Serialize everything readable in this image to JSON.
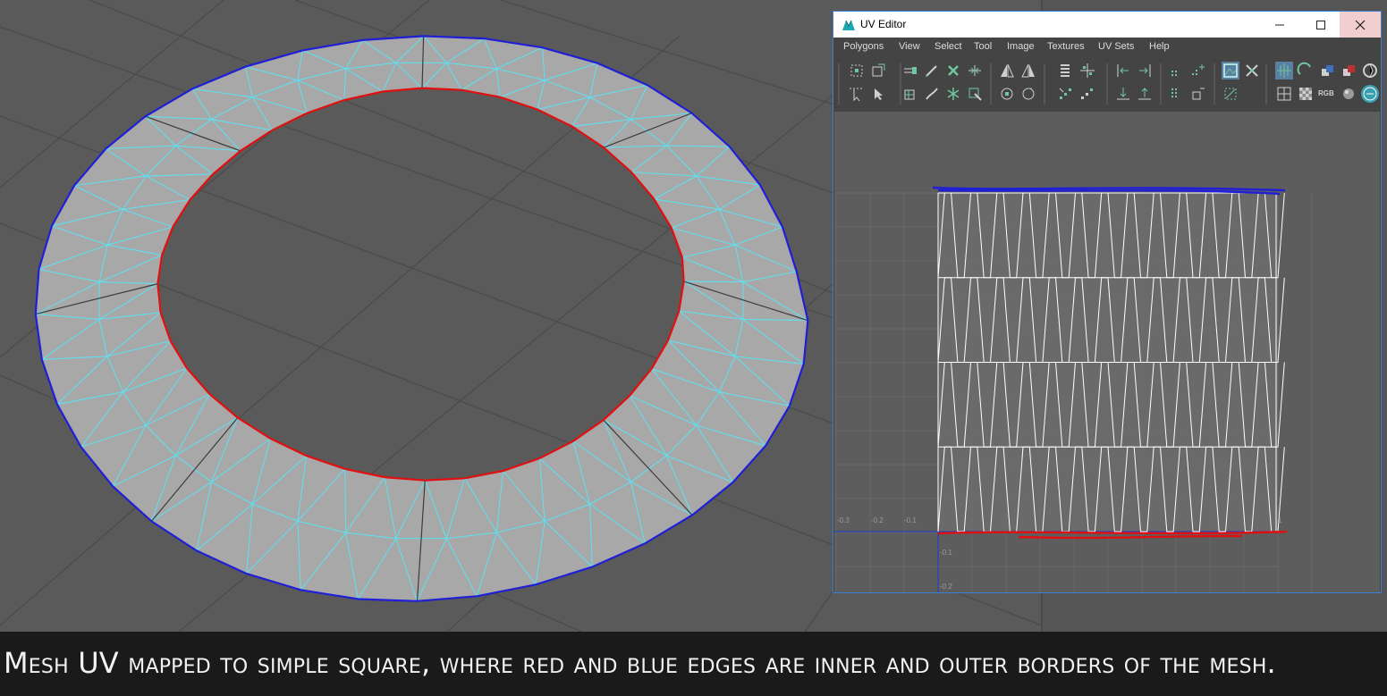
{
  "uv_editor": {
    "title": "UV Editor",
    "menu": [
      "Polygons",
      "View",
      "Select",
      "Tool",
      "Image",
      "Textures",
      "UV Sets",
      "Help"
    ],
    "toolbar_text": {
      "rgb_label": "RGB"
    },
    "axis_labels": {
      "u_negative": [
        "-0.3",
        "-0.2",
        "-0.1"
      ],
      "v_negative": [
        "-0.1",
        "-0.2"
      ],
      "u_one": "1"
    }
  },
  "caption": "Mesh UV mapped to simple square, where red and blue edges are inner and outer borders of the mesh.",
  "colors": {
    "outer_border": "#1f1fd6",
    "inner_border": "#e01010",
    "wireframe": "#5fe0f0",
    "mesh_fill": "#a8a8a8",
    "uv_lines": "#ffffff",
    "viewport_bg": "#5a5a5a"
  }
}
